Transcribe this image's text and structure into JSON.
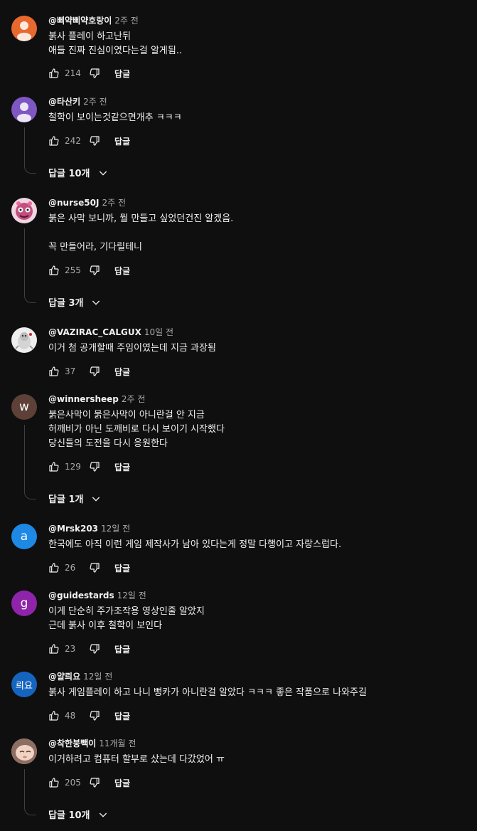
{
  "labels": {
    "reply": "답글"
  },
  "comments": [
    {
      "author": "@삐약삐약호랑이",
      "time": "2주 전",
      "lines": [
        "붉사 플레이 하고난뒤",
        "애들 진짜 진심이였다는걸 알게됨.."
      ],
      "likes": "214",
      "avatar": {
        "type": "person",
        "color": "#e8692d"
      }
    },
    {
      "author": "@타산키",
      "time": "2주 전",
      "lines": [
        "철학이 보이는것같으면개추 ㅋㅋㅋ"
      ],
      "likes": "242",
      "replies": "답글 10개",
      "avatar": {
        "type": "person",
        "color": "#7e57c2"
      }
    },
    {
      "author": "@nurse50J",
      "time": "2주 전",
      "lines": [
        "붉은 사막 보니까, 뭘 만들고 싶었던건진 알겠음.",
        "",
        "꼭 만들어라, 기다릴테니"
      ],
      "likes": "255",
      "replies": "답글 3개",
      "avatar": {
        "type": "art",
        "color": "#b2547a"
      }
    },
    {
      "author": "@VAZIRAC_CALGUX",
      "time": "10일 전",
      "lines": [
        "이거 첨 공개할때 주임이였는데 지금 과장됨"
      ],
      "likes": "37",
      "avatar": {
        "type": "art",
        "color": "#d9d9d9"
      }
    },
    {
      "author": "@winnersheep",
      "time": "2주 전",
      "lines": [
        "붉은사막이 묽은사막이 아니란걸 안 지금",
        "허깨비가 아닌 도깨비로 다시 보이기 시작했다",
        "당신들의 도전을 다시 응원한다"
      ],
      "likes": "129",
      "replies": "답글 1개",
      "avatar": {
        "type": "letter",
        "letter": "w",
        "color": "#5d4037"
      }
    },
    {
      "author": "@Mrsk203",
      "time": "12일 전",
      "lines": [
        "한국에도 아직 이런 게임 제작사가 남아 있다는게 정말 다행이고 자랑스럽다."
      ],
      "likes": "26",
      "avatar": {
        "type": "letter",
        "letter": "a",
        "color": "#1e88e5"
      }
    },
    {
      "author": "@guidestards",
      "time": "12일 전",
      "lines": [
        "이게 단순히 주가조작용 영상인줄 알았지",
        "근데 붉사 이후 철학이 보인다"
      ],
      "likes": "23",
      "avatar": {
        "type": "letter",
        "letter": "g",
        "color": "#8e24aa"
      }
    },
    {
      "author": "@얄릐요",
      "time": "12일 전",
      "lines": [
        "붉사 게임플레이 하고 나니 뻥카가 아니란걸 알았다 ㅋㅋㅋ 좋은 작품으로 나와주길"
      ],
      "likes": "48",
      "avatar": {
        "type": "letter",
        "letter": "릐요",
        "color": "#1565c0"
      }
    },
    {
      "author": "@착한붕빽이",
      "time": "11개월 전",
      "lines": [
        "이거하려고 컴퓨터 할부로 샀는데 다갔었어 ㅠ"
      ],
      "likes": "205",
      "replies": "답글 10개",
      "avatar": {
        "type": "art",
        "color": "#c9a89a"
      }
    }
  ]
}
